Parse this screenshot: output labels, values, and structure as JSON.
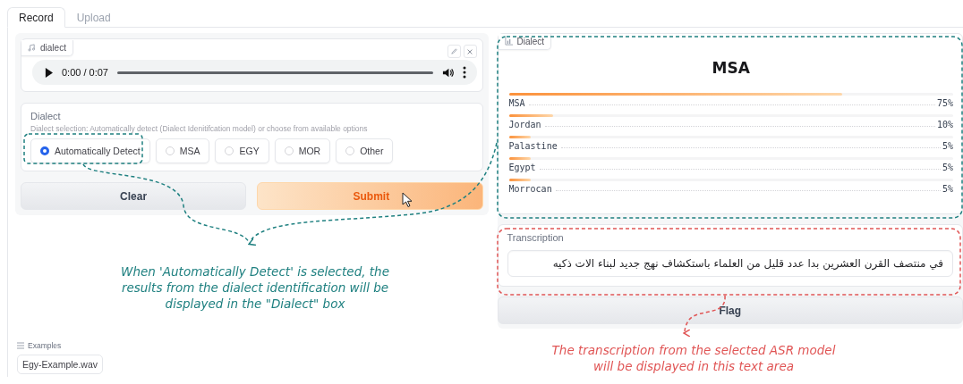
{
  "tabs": [
    {
      "label": "Record",
      "selected": true
    },
    {
      "label": "Upload",
      "selected": false
    }
  ],
  "audio": {
    "label": "dialect",
    "time": "0:00 / 0:07"
  },
  "dialect": {
    "label": "Dialect",
    "info": "Dialect selection: Automatically detect (Dialect Idenitifcation model) or choose from available options",
    "options": [
      {
        "label": "Automatically Detect",
        "selected": true
      },
      {
        "label": "MSA",
        "selected": false
      },
      {
        "label": "EGY",
        "selected": false
      },
      {
        "label": "MOR",
        "selected": false
      },
      {
        "label": "Other",
        "selected": false
      }
    ]
  },
  "buttons": [
    {
      "label": "Clear",
      "kind": "secondary"
    },
    {
      "label": "Submit",
      "kind": "primary"
    }
  ],
  "examples": {
    "label": "Examples",
    "items": [
      "Egy-Example.wav"
    ]
  },
  "dialect_output": {
    "label": "Dialect",
    "top": "MSA",
    "confidences": [
      {
        "label": "MSA",
        "reading": "75%",
        "level": 0.75
      },
      {
        "label": "Jordan",
        "reading": "10%",
        "level": 0.1
      },
      {
        "label": "Palastine",
        "reading": "5%",
        "level": 0.05
      },
      {
        "label": "Egypt",
        "reading": "5%",
        "level": 0.05
      },
      {
        "label": "Morrocan",
        "reading": "5%",
        "level": 0.05
      }
    ]
  },
  "transcription": {
    "label": "Transcription",
    "value": "في منتصف القرن العشرين بدا عدد قليل من العلماء باستكشاف نهج جديد لبناء الات ذكيه"
  },
  "flag_button": {
    "label": "Flag"
  },
  "annotations": [
    {
      "text": "When 'Automatically Detect' is selected, the results from the dialect identification will be displayed in the \"Dialect\" box",
      "color": "#1f8080"
    },
    {
      "text": "The transcription from the selected ASR model will be displayed in this text area",
      "color": "#e05555"
    }
  ]
}
